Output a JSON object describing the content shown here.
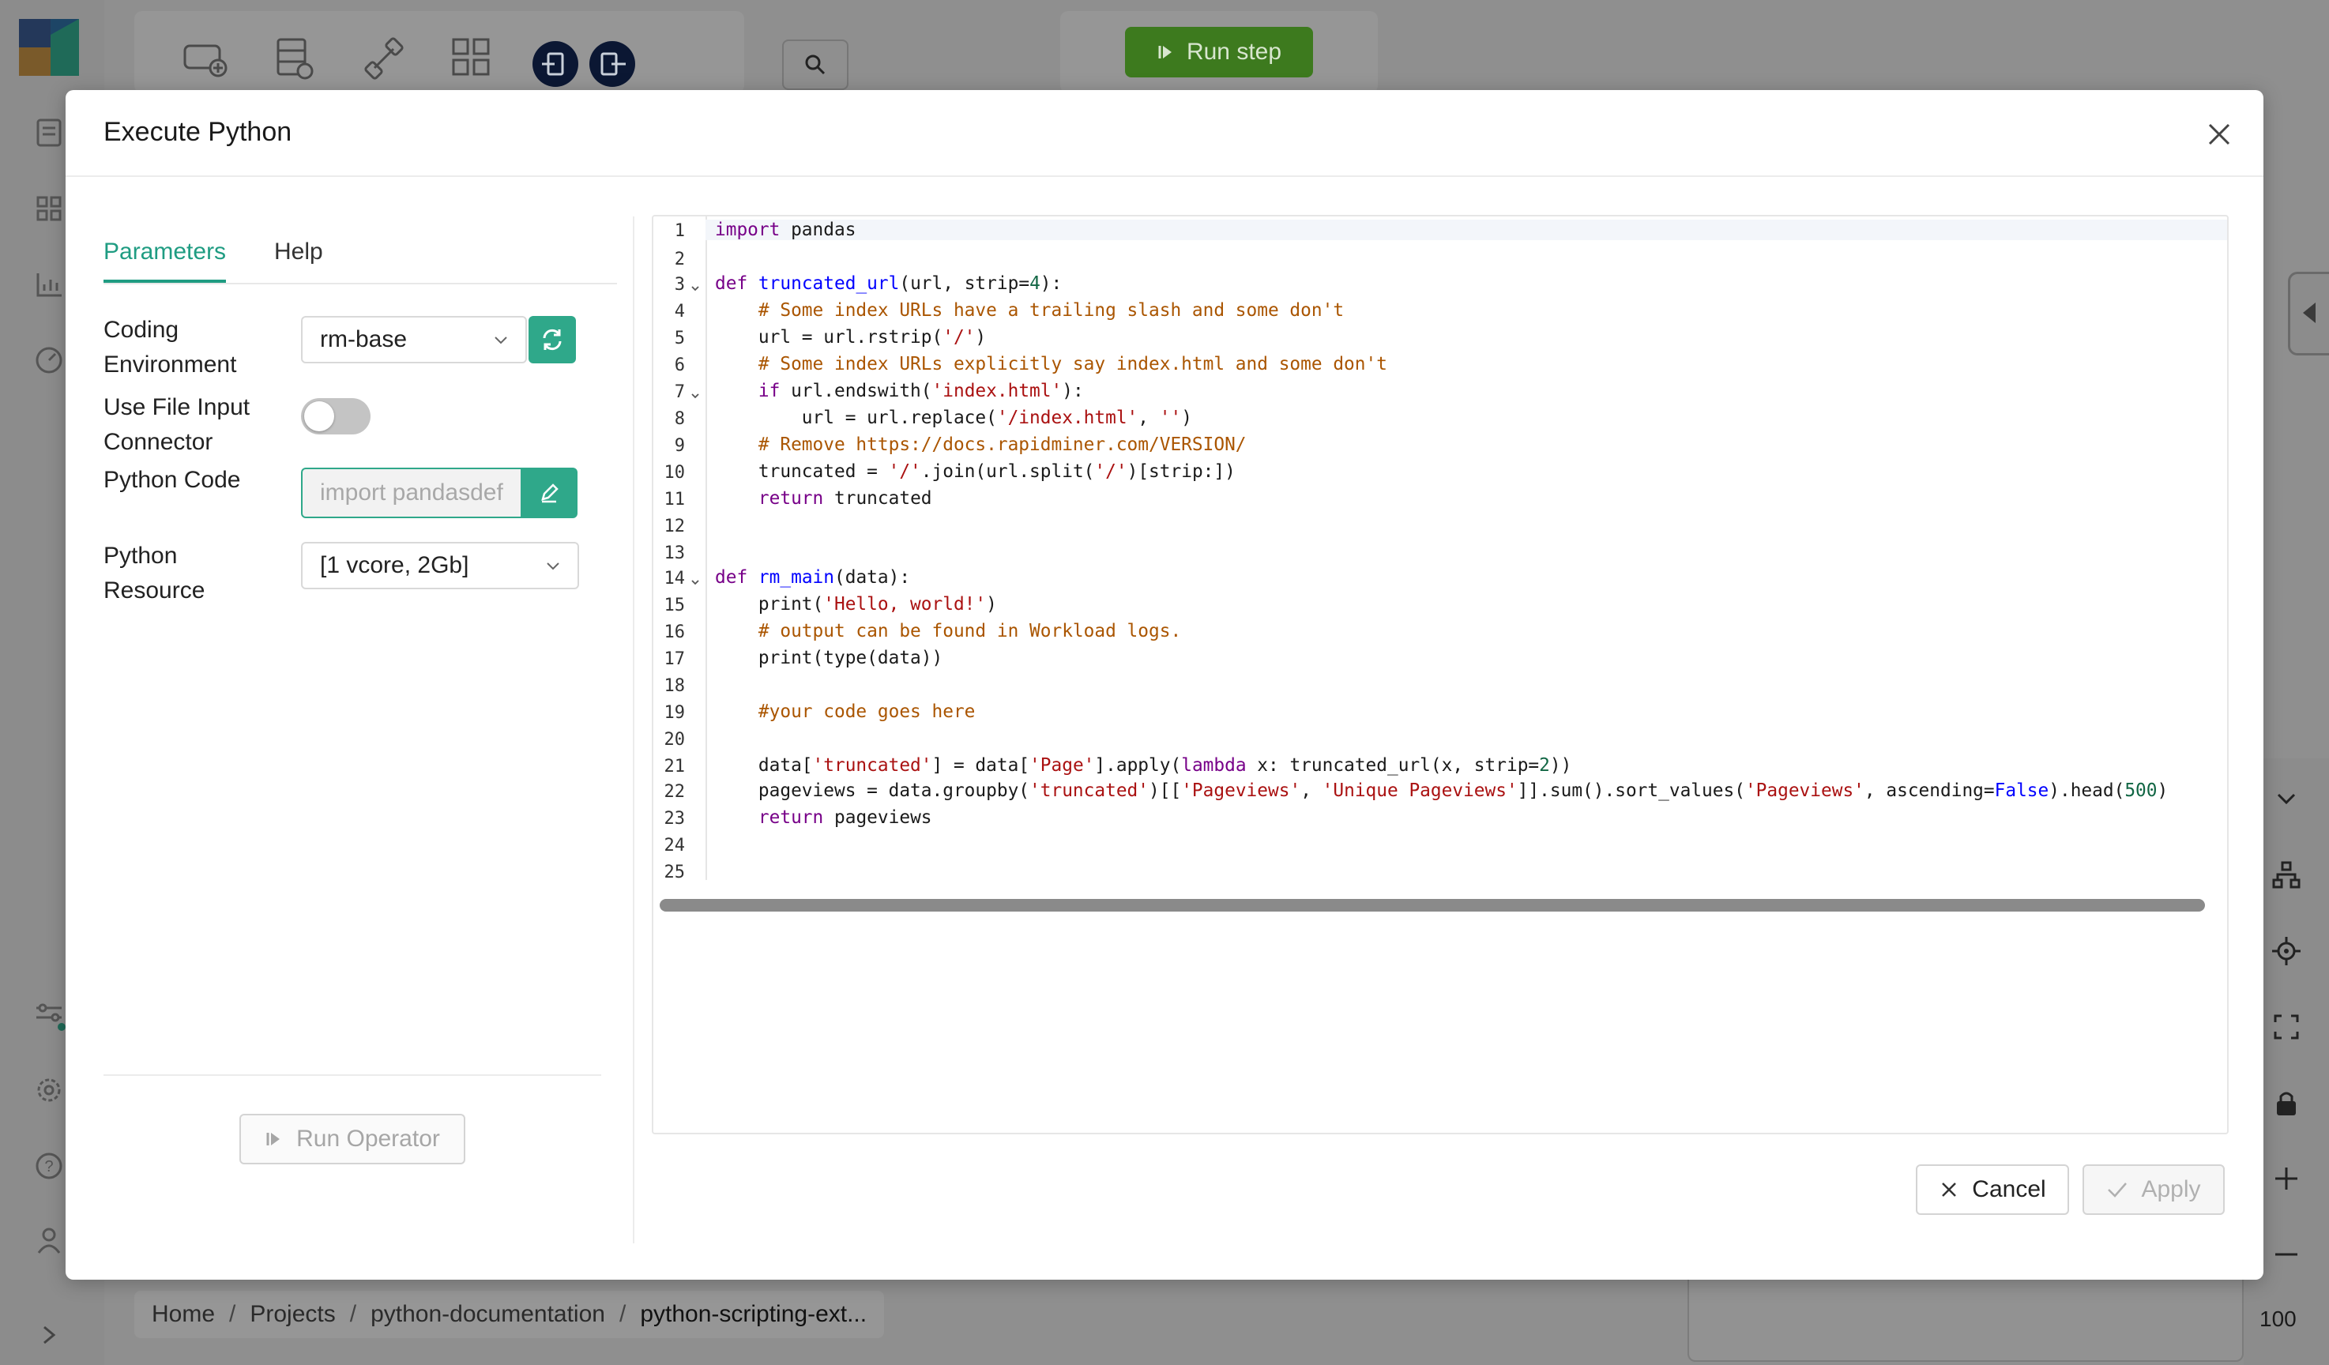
{
  "background": {
    "run_step_label": "Run step",
    "zoom_level": "100",
    "breadcrumb": [
      "Home",
      "Projects",
      "python-documentation",
      "python-scripting-ext..."
    ],
    "breadcrumb_separator": "/"
  },
  "modal": {
    "title": "Execute Python",
    "tabs": [
      {
        "label": "Parameters",
        "active": true
      },
      {
        "label": "Help",
        "active": false
      }
    ],
    "params": {
      "coding_environment": {
        "label": "Coding Environment",
        "value": "rm-base"
      },
      "use_file_input": {
        "label": "Use File Input Connector",
        "checked": false
      },
      "python_code": {
        "label": "Python Code",
        "value": "import pandasdef"
      },
      "python_resource": {
        "label": "Python Resource",
        "value": "[1 vcore, 2Gb]"
      }
    },
    "run_operator_label": "Run Operator",
    "cancel_label": "Cancel",
    "apply_label": "Apply"
  },
  "editor": {
    "line_numbers": [
      "1",
      "2",
      "3",
      "4",
      "5",
      "6",
      "7",
      "8",
      "9",
      "10",
      "11",
      "12",
      "13",
      "14",
      "15",
      "16",
      "17",
      "18",
      "19",
      "20",
      "21",
      "22",
      "23",
      "24",
      "25"
    ],
    "fold_lines": [
      3,
      7,
      14
    ]
  },
  "colors": {
    "accent": "#2fa88a",
    "run_step_green": "#3d7a1e",
    "code_keyword": "#770088",
    "code_def": "#0000ff",
    "code_string": "#aa1111",
    "code_comment": "#aa5500",
    "code_number": "#116644"
  }
}
